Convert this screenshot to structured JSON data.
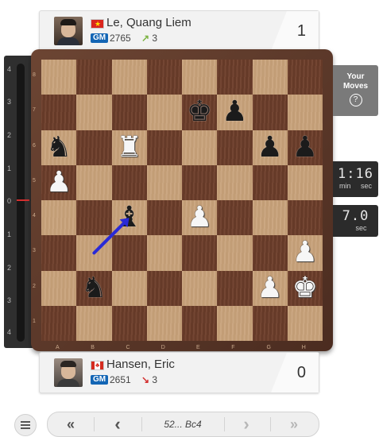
{
  "top_player": {
    "name": "Le, Quang Liem",
    "title": "GM",
    "rating": "2765",
    "delta": "3",
    "delta_arrow": "↗",
    "score": "1",
    "flag": "vietnam-flag"
  },
  "bottom_player": {
    "name": "Hansen, Eric",
    "title": "GM",
    "rating": "2651",
    "delta": "3",
    "delta_arrow": "↘",
    "score": "0",
    "flag": "canada-flag"
  },
  "eval_bar": {
    "ticks_top": [
      "4",
      "3",
      "2",
      "1",
      "0"
    ],
    "ticks_bottom": [
      "1",
      "2",
      "3",
      "4"
    ]
  },
  "side": {
    "your_moves_line1": "Your",
    "your_moves_line2": "Moves",
    "help_glyph": "?"
  },
  "clock_top": {
    "digits": "1:16",
    "label_min": "min",
    "label_sec": "sec"
  },
  "clock_bottom": {
    "digits": "7.0",
    "label_sec": "sec"
  },
  "board": {
    "files": [
      "A",
      "B",
      "C",
      "D",
      "E",
      "F",
      "G",
      "H"
    ],
    "ranks": [
      "8",
      "7",
      "6",
      "5",
      "4",
      "3",
      "2",
      "1"
    ],
    "pieces": [
      {
        "sq": "e7",
        "glyph": "♚",
        "color": "black",
        "name": "black-king"
      },
      {
        "sq": "f7",
        "glyph": "♟",
        "color": "black",
        "name": "black-pawn"
      },
      {
        "sq": "a6",
        "glyph": "♞",
        "color": "black",
        "name": "black-knight"
      },
      {
        "sq": "c6",
        "glyph": "♜",
        "color": "white",
        "name": "white-rook"
      },
      {
        "sq": "g6",
        "glyph": "♟",
        "color": "black",
        "name": "black-pawn"
      },
      {
        "sq": "h6",
        "glyph": "♟",
        "color": "black",
        "name": "black-pawn"
      },
      {
        "sq": "a5",
        "glyph": "♟",
        "color": "white",
        "name": "white-pawn"
      },
      {
        "sq": "c4",
        "glyph": "♝",
        "color": "black",
        "name": "black-bishop"
      },
      {
        "sq": "e4",
        "glyph": "♟",
        "color": "white",
        "name": "white-pawn"
      },
      {
        "sq": "h3",
        "glyph": "♟",
        "color": "white",
        "name": "white-pawn"
      },
      {
        "sq": "b2",
        "glyph": "♞",
        "color": "black",
        "name": "black-knight"
      },
      {
        "sq": "g2",
        "glyph": "♟",
        "color": "white",
        "name": "white-pawn"
      },
      {
        "sq": "h2",
        "glyph": "♚",
        "color": "white",
        "name": "white-king"
      }
    ],
    "last_move": {
      "from": "b3",
      "to": "c4",
      "arrow_color": "#2a2ad6"
    }
  },
  "nav": {
    "first": "«",
    "prev": "‹",
    "move": "52... Bc4",
    "next": "›",
    "last": "»"
  },
  "colors": {
    "light_square": "#c8a27a",
    "dark_square": "#6e3f2b",
    "gm_badge": "#1466b5"
  }
}
